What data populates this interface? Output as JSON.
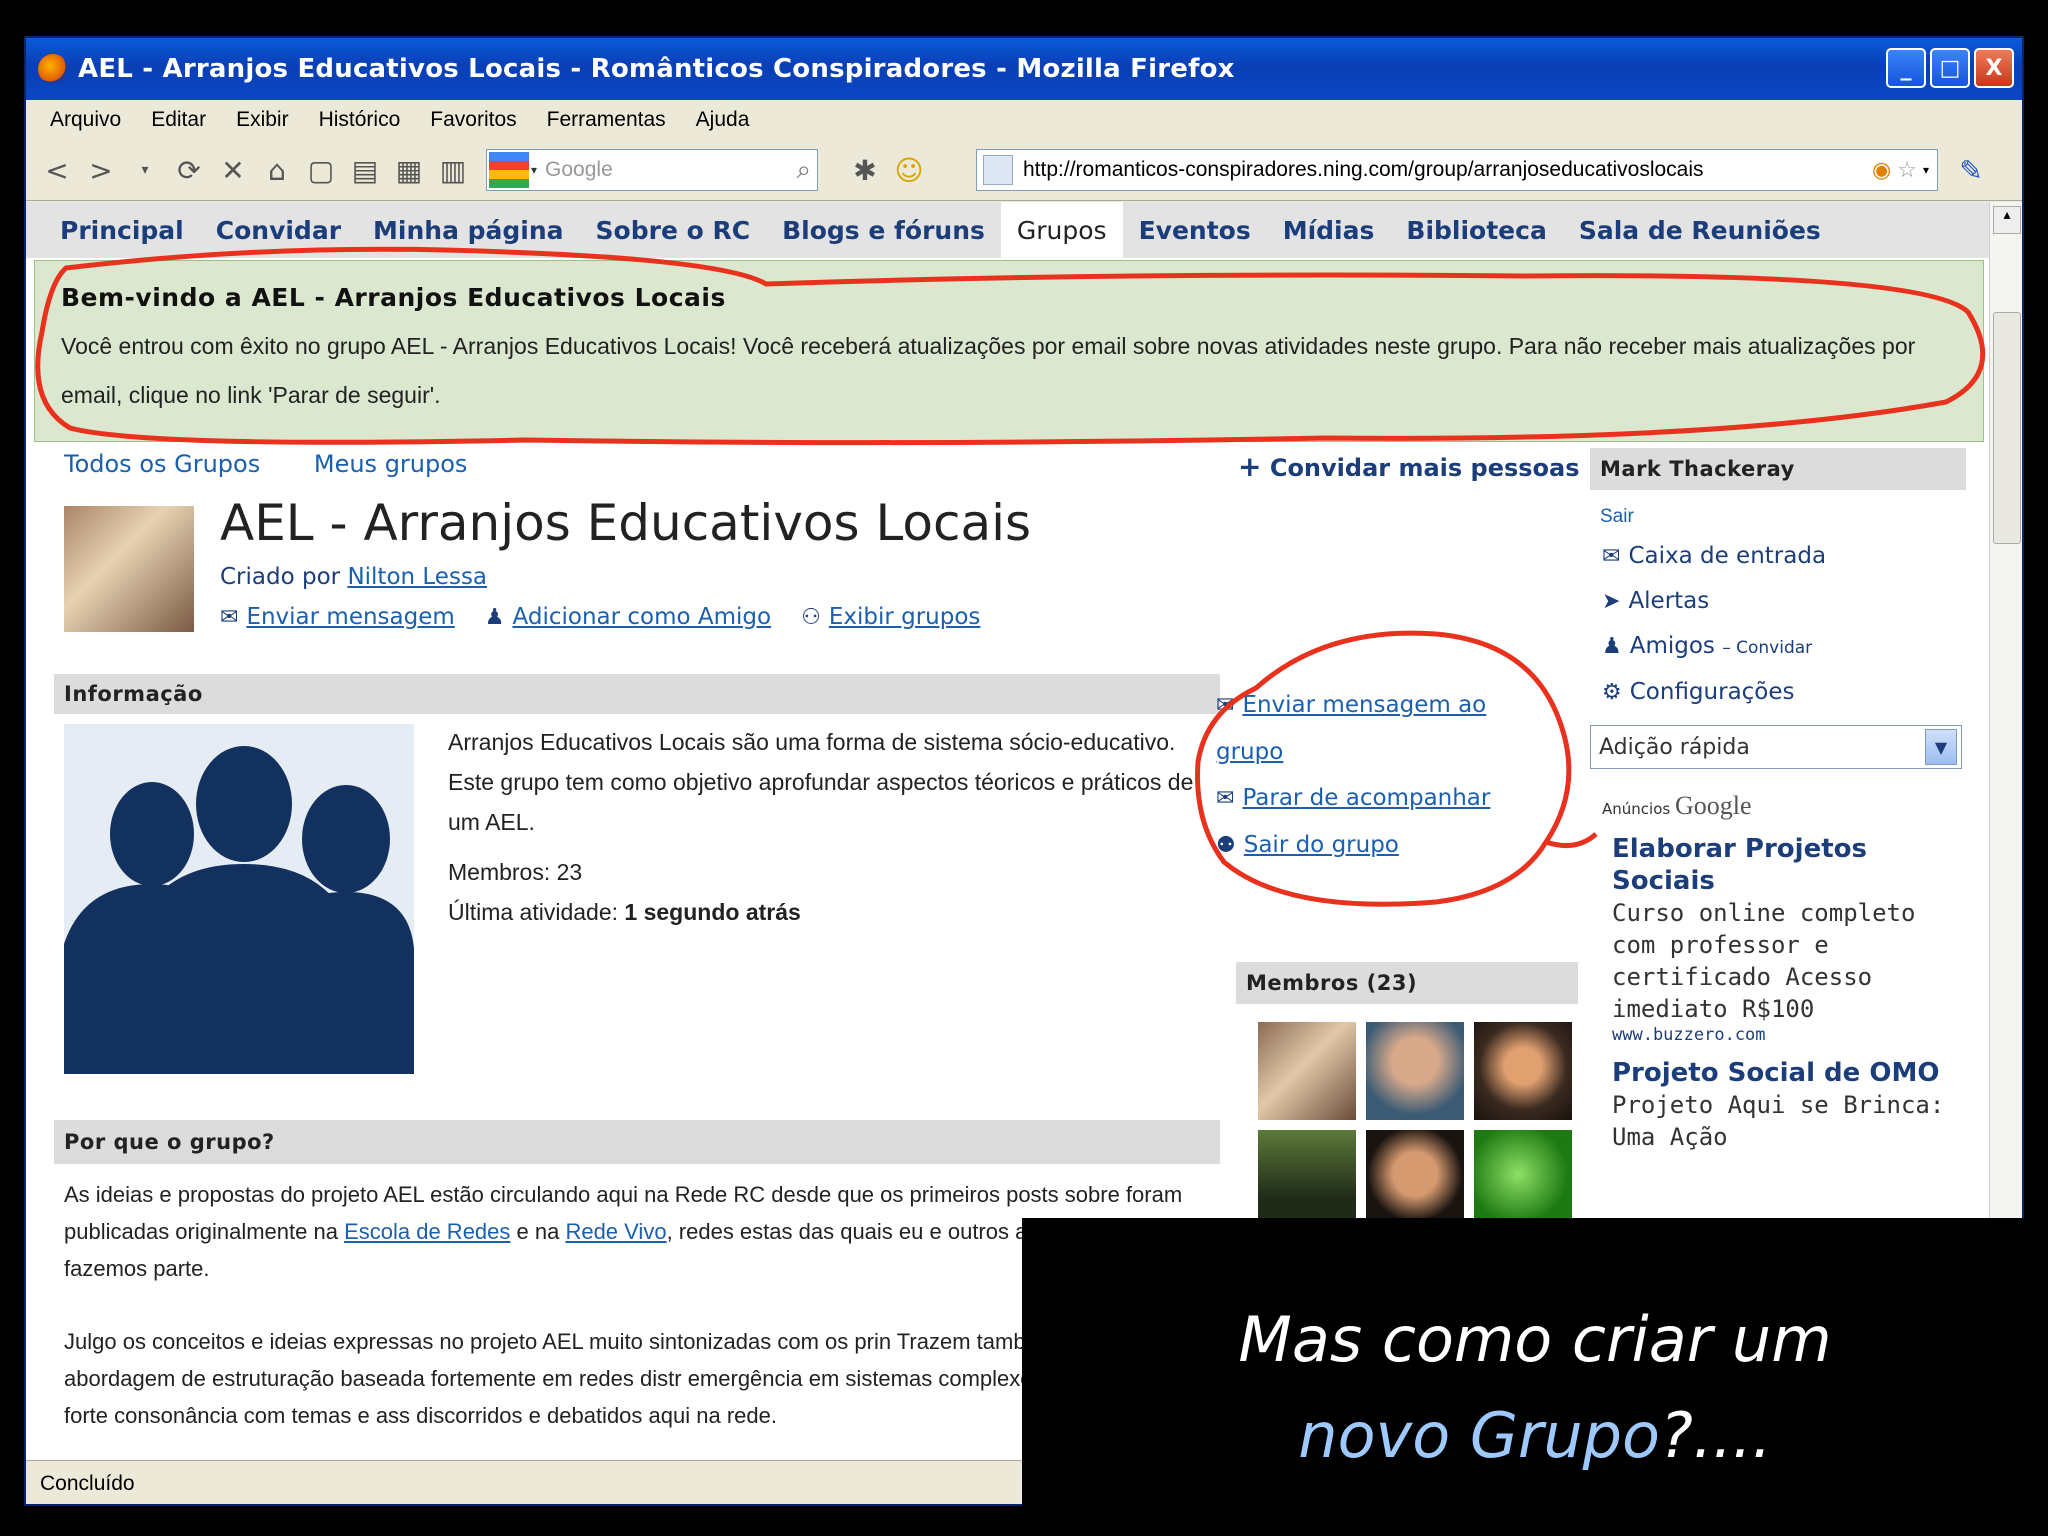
{
  "window": {
    "title": "AEL - Arranjos Educativos Locais - Românticos Conspiradores - Mozilla Firefox",
    "buttons": {
      "minimize": "_",
      "maximize": "□",
      "close": "X"
    }
  },
  "menu": [
    "Arquivo",
    "Editar",
    "Exibir",
    "Histórico",
    "Favoritos",
    "Ferramentas",
    "Ajuda"
  ],
  "toolbar": {
    "search_placeholder": "Google",
    "url": "http://romanticos-conspiradores.ning.com/group/arranjoseducativoslocais"
  },
  "nav": {
    "items": [
      "Principal",
      "Convidar",
      "Minha página",
      "Sobre o RC",
      "Blogs e fóruns",
      "Grupos",
      "Eventos",
      "Mídias",
      "Biblioteca",
      "Sala de Reuniões"
    ],
    "active": "Grupos"
  },
  "welcome": {
    "title": "Bem-vindo a AEL - Arranjos Educativos Locais",
    "message": "Você entrou com êxito no grupo AEL - Arranjos Educativos Locais! Você receberá atualizações por email sobre novas atividades neste grupo. Para não receber mais atualizações por email, clique no link 'Parar de seguir'."
  },
  "sublinks": {
    "all": "Todos os Grupos",
    "mine": "Meus grupos",
    "invite": "Convidar mais pessoas"
  },
  "group": {
    "title": "AEL - Arranjos Educativos Locais",
    "created_by_label": "Criado por",
    "creator": "Nilton Lessa",
    "actions": {
      "message": "Enviar mensagem",
      "add_friend": "Adicionar como Amigo",
      "view_groups": "Exibir grupos"
    }
  },
  "info": {
    "heading": "Informação",
    "description": "Arranjos Educativos Locais são uma forma de sistema sócio-educativo. Este grupo tem como objetivo aprofundar aspectos téoricos e práticos de um AEL.",
    "members_label": "Membros:",
    "members_count": "23",
    "last_activity_label": "Última atividade:",
    "last_activity": "1 segundo atrás"
  },
  "group_actions": {
    "message_line1": "Enviar mensagem ao",
    "message_line2": "grupo",
    "unfollow": "Parar de acompanhar",
    "leave": "Sair do grupo"
  },
  "members_box": {
    "heading": "Membros (23)"
  },
  "why": {
    "heading": "Por que o grupo?",
    "p1_a": "As ideias e propostas do projeto AEL estão circulando aqui na Rede RC desde que os primeiros posts sobre foram publicadas originalmente na ",
    "link1": "Escola de Redes",
    "p1_b": " e na ",
    "link2": "Rede Vivo",
    "p1_c": ", redes estas das quais eu e outros amigos do RC fazemos parte.",
    "p2": "Julgo os conceitos e ideias expressas no projeto AEL muito sintonizadas com os prin Trazem também uma abordagem de estruturação baseada fortemente em redes distr emergência em sistemas complexos. Há portanto forte consonância com temas e ass discorridos e debatidos aqui na rede."
  },
  "sidebar": {
    "user": "Mark Thackeray",
    "logout": "Sair",
    "inbox": "Caixa de entrada",
    "alerts": "Alertas",
    "friends": "Amigos",
    "invite": "– Convidar",
    "settings": "Configurações",
    "quick_add": "Adição rápida"
  },
  "ads": {
    "label": "Anúncios",
    "brand": "Google",
    "ad1": {
      "title": "Elaborar Projetos Sociais",
      "body": "Curso online completo com professor e certificado Acesso imediato R$100",
      "url": "www.buzzero.com"
    },
    "ad2": {
      "title": "Projeto Social de OMO",
      "body": "Projeto Aqui se Brinca: Uma Ação"
    }
  },
  "status": "Concluído",
  "caption": {
    "line1": "Mas como criar um",
    "highlight": "novo Grupo",
    "tail": "?...."
  },
  "colors": {
    "accent_red": "#e8321e",
    "link_blue": "#1b5fae",
    "welcome_bg": "#dbe8cf",
    "silhouette": "#12315e"
  }
}
